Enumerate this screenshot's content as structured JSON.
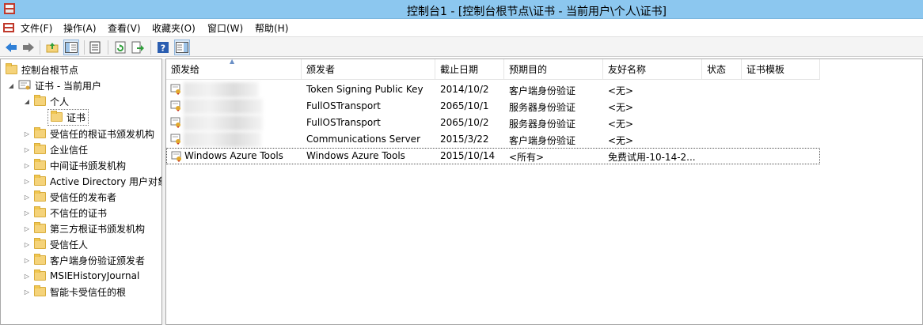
{
  "window": {
    "title": "控制台1 - [控制台根节点\\证书 - 当前用户\\个人\\证书]"
  },
  "menu": {
    "items": [
      "文件(F)",
      "操作(A)",
      "查看(V)",
      "收藏夹(O)",
      "窗口(W)",
      "帮助(H)"
    ]
  },
  "toolbar": {
    "icons": [
      "back-arrow-icon",
      "forward-arrow-icon",
      "up-folder-icon",
      "show-hide-tree-icon",
      "properties-icon",
      "refresh-icon",
      "export-list-icon",
      "help-icon",
      "show-hide-action-pane-icon"
    ]
  },
  "tree": {
    "root": "控制台根节点",
    "store": "证书 - 当前用户",
    "personal": "个人",
    "certs": "证书",
    "folders": [
      "受信任的根证书颁发机构",
      "企业信任",
      "中间证书颁发机构",
      "Active Directory 用户对象",
      "受信任的发布者",
      "不信任的证书",
      "第三方根证书颁发机构",
      "受信任人",
      "客户端身份验证颁发者",
      "MSIEHistoryJournal",
      "智能卡受信任的根"
    ]
  },
  "list": {
    "columns": [
      "颁发给",
      "颁发者",
      "截止日期",
      "预期目的",
      "友好名称",
      "状态",
      "证书模板"
    ],
    "rows": [
      {
        "issued_to": "",
        "issuer": "Token Signing Public Key",
        "expiry": "2014/10/2",
        "purpose": "客户端身份验证",
        "friendly": "<无>"
      },
      {
        "issued_to": "",
        "issuer": "FullOSTransport",
        "expiry": "2065/10/1",
        "purpose": "服务器身份验证",
        "friendly": "<无>"
      },
      {
        "issued_to": "",
        "issuer": "FullOSTransport",
        "expiry": "2065/10/2",
        "purpose": "服务器身份验证",
        "friendly": "<无>"
      },
      {
        "issued_to": "",
        "issuer": "Communications Server",
        "expiry": "2015/3/22",
        "purpose": "客户端身份验证",
        "friendly": "<无>"
      },
      {
        "issued_to": "Windows Azure Tools",
        "issuer": "Windows Azure Tools",
        "expiry": "2015/10/14",
        "purpose": "<所有>",
        "friendly": "免费试用-10-14-2..."
      }
    ]
  },
  "colors": {
    "titlebar": "#8cc7ef",
    "folder": "#f5d37a"
  }
}
